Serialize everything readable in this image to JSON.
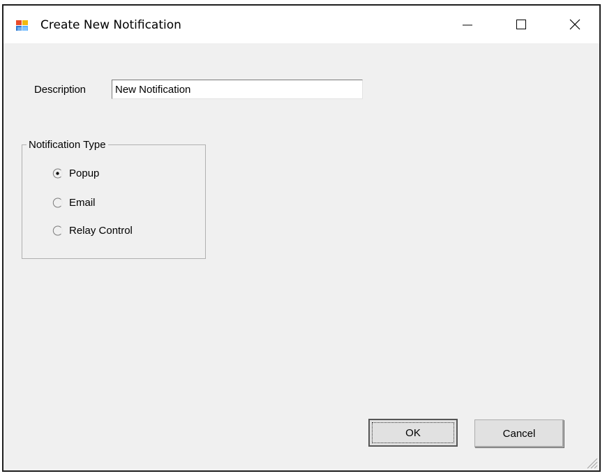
{
  "window": {
    "title": "Create New Notification",
    "icon": "app-icon",
    "controls": [
      "minimize-icon",
      "maximize-icon",
      "close-icon"
    ]
  },
  "description": {
    "label": "Description",
    "value": "New Notification"
  },
  "notification_type": {
    "group_title": "Notification Type",
    "options": [
      {
        "label": "Popup",
        "selected": true
      },
      {
        "label": "Email",
        "selected": false
      },
      {
        "label": "Relay Control",
        "selected": false
      }
    ]
  },
  "buttons": {
    "ok_label": "OK",
    "cancel_label": "Cancel"
  },
  "colors": {
    "window_background": "#f0f0f0",
    "titlebar_background": "#ffffff"
  }
}
